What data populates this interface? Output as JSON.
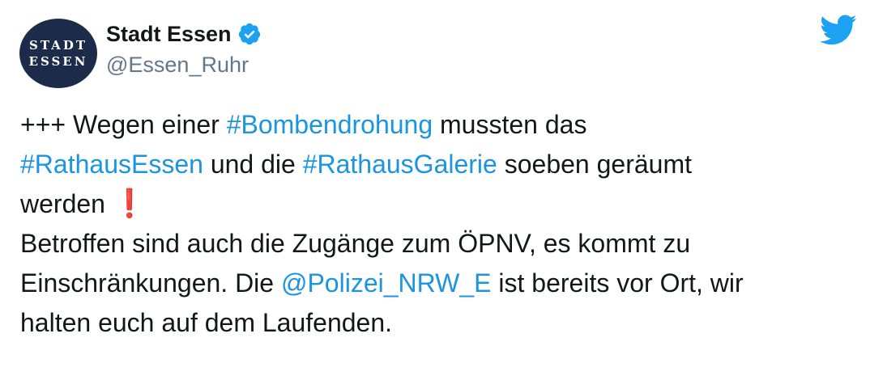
{
  "author": {
    "display_name": "Stadt Essen",
    "handle": "@Essen_Ruhr",
    "avatar_lines": [
      "STADT",
      "ESSEN"
    ],
    "verified": true
  },
  "icons": {
    "verified": "verified-badge-icon",
    "brand": "twitter-bird-icon"
  },
  "colors": {
    "link": "#1b95e0",
    "text": "#14171a",
    "handle": "#657786",
    "avatar_bg": "#1c2b4a",
    "brand": "#1da1f2",
    "exclamation": "#d9242b"
  },
  "tweet": {
    "line1_prefix": "+++ Wegen einer ",
    "hashtag1": "#Bombendrohung",
    "line1_suffix": " mussten das",
    "hashtag2": "#RathausEssen",
    "mid1": " und die ",
    "hashtag3": "#RathausGalerie",
    "line2_suffix": " soeben geräumt",
    "line3": "werden ",
    "emoji": "❗",
    "line4": "Betroffen sind auch die Zugänge zum ÖPNV, es kommt zu",
    "line5_prefix": "Einschränkungen. Die ",
    "mention": "@Polizei_NRW_E",
    "line5_suffix": " ist bereits vor Ort, wir",
    "line6": "halten euch auf dem Laufenden."
  }
}
